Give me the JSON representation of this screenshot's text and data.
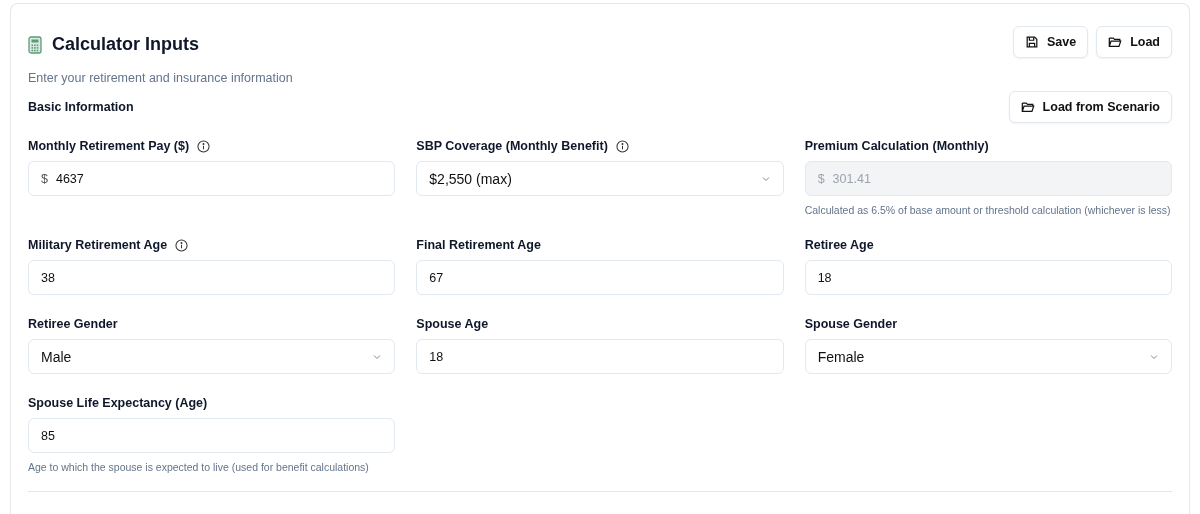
{
  "header": {
    "title": "Calculator Inputs",
    "subtitle": "Enter your retirement and insurance information",
    "buttons": [
      {
        "label": "Save"
      },
      {
        "label": "Load"
      }
    ]
  },
  "section": {
    "title": "Basic Information",
    "button": {
      "label": "Load from Scenario"
    }
  },
  "fields": [
    {
      "label": "Monthly Retirement Pay ($)",
      "info": true,
      "kind": "currency",
      "prefix": "$",
      "value": "4637",
      "disabled": false
    },
    {
      "label": "SBP Coverage (Monthly Benefit)",
      "info": true,
      "kind": "select",
      "value": "$2,550 (max)",
      "disabled": false
    },
    {
      "label": "Premium Calculation (Monthly)",
      "info": false,
      "kind": "currency",
      "prefix": "$",
      "value": "301.41",
      "disabled": true,
      "hint": "Calculated as 6.5% of base amount or threshold calculation (whichever is less)"
    },
    {
      "label": "Military Retirement Age",
      "info": true,
      "kind": "number",
      "value": "38",
      "disabled": false
    },
    {
      "label": "Final Retirement Age",
      "info": false,
      "kind": "number",
      "value": "67",
      "disabled": false
    },
    {
      "label": "Retiree Age",
      "info": false,
      "kind": "number",
      "value": "18",
      "disabled": false
    },
    {
      "label": "Retiree Gender",
      "info": false,
      "kind": "select",
      "value": "Male",
      "disabled": false
    },
    {
      "label": "Spouse Age",
      "info": false,
      "kind": "number",
      "value": "18",
      "disabled": false
    },
    {
      "label": "Spouse Gender",
      "info": false,
      "kind": "select",
      "value": "Female",
      "disabled": false
    },
    {
      "label": "Spouse Life Expectancy (Age)",
      "info": false,
      "kind": "number",
      "value": "85",
      "disabled": false,
      "hint": "Age to which the spouse is expected to live (used for benefit calculations)"
    }
  ]
}
